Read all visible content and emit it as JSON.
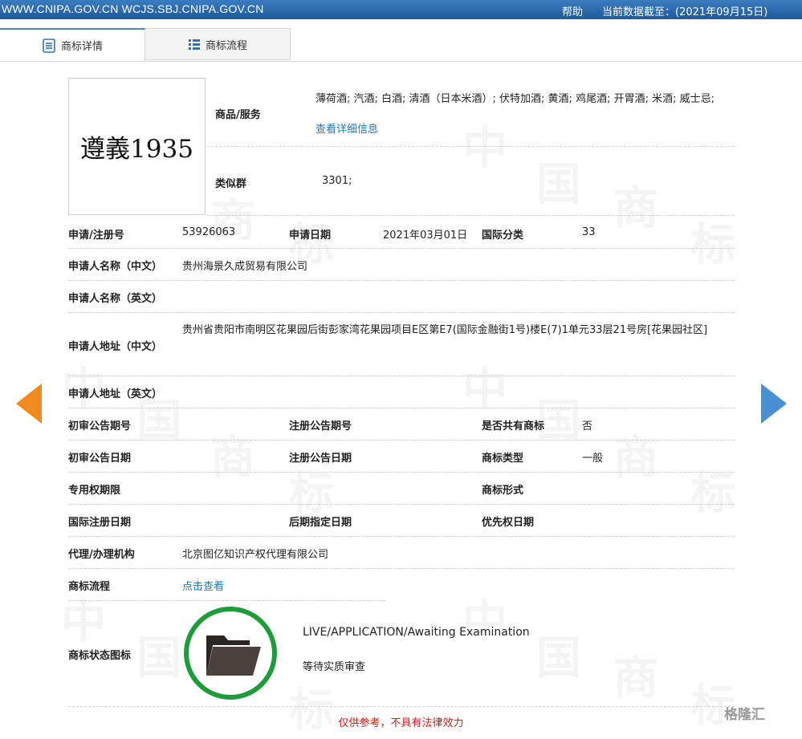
{
  "topbar": {
    "site": "WWW.CNIPA.GOV.CN WCJS.SBJ.CNIPA.GOV.CN",
    "help": "帮助",
    "data_date": "当前数据截至：(2021年09月15日)"
  },
  "tabs": [
    {
      "label": "商标详情",
      "active": true
    },
    {
      "label": "商标流程",
      "active": false
    }
  ],
  "watermark": [
    "中",
    "国",
    "商",
    "标"
  ],
  "trademark": {
    "image_text": "遵義1935",
    "goods_label": "商品/服务",
    "goods_value": "薄荷酒; 汽酒; 白酒; 清酒（日本米酒）; 伏特加酒; 黄酒; 鸡尾酒; 开胃酒; 米酒; 威士忌;",
    "goods_link": "查看详细信息",
    "similar_label": "类似群",
    "similar_value": "3301;"
  },
  "fields": {
    "reg_no_label": "申请/注册号",
    "reg_no": "53926063",
    "app_date_label": "申请日期",
    "app_date": "2021年03月01日",
    "intl_class_label": "国际分类",
    "intl_class": "33",
    "applicant_cn_label": "申请人名称（中文）",
    "applicant_cn": "贵州海景久成贸易有限公司",
    "applicant_en_label": "申请人名称（英文）",
    "address_cn_label": "申请人地址（中文）",
    "address_cn": "贵州省贵阳市南明区花果园后街彭家湾花果园项目E区第E7(国际金融街1号)楼E(7)1单元33层21号房[花果园社区]",
    "address_en_label": "申请人地址（英文）",
    "prelim_pub_no_label": "初审公告期号",
    "reg_pub_no_label": "注册公告期号",
    "shared_label": "是否共有商标",
    "shared": "否",
    "prelim_pub_date_label": "初审公告日期",
    "reg_pub_date_label": "注册公告日期",
    "type_label": "商标类型",
    "type": "一般",
    "exclusive_label": "专用权期限",
    "form_label": "商标形式",
    "intl_reg_date_label": "国际注册日期",
    "later_date_label": "后期指定日期",
    "priority_date_label": "优先权日期",
    "agent_label": "代理/办理机构",
    "agent": "北京图亿知识产权代理有限公司",
    "flow_label": "商标流程",
    "flow_link": "点击查看",
    "status_label": "商标状态图标",
    "status_en": "LIVE/APPLICATION/Awaiting Examination",
    "status_cn": "等待实质审查"
  },
  "footer": {
    "note": "仅供参考，不具有法律效力",
    "logo": "格隆汇"
  },
  "colors": {
    "topbar": "#2d6fb3",
    "link": "#1f79b8",
    "prev_arrow": "#f08a1c",
    "next_arrow": "#4a8fd1",
    "status_ring": "#1f9c3a",
    "note": "#d0201a"
  }
}
